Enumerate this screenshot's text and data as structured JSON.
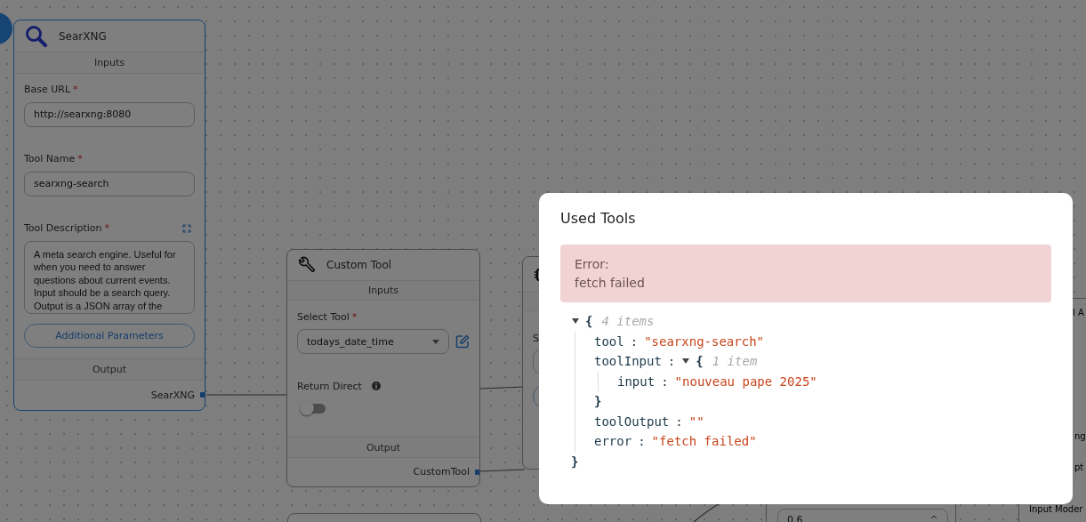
{
  "canvas": {
    "nodes": [
      {
        "kind": "tool",
        "title": "SearXNG",
        "selected": true,
        "inputs_heading": "Inputs",
        "fields": [
          {
            "kind": "text",
            "label": "Base URL",
            "required_mark": "*",
            "value": "http://searxng:8080"
          },
          {
            "kind": "text",
            "label": "Tool Name",
            "required_mark": "*",
            "value": "searxng-search"
          },
          {
            "kind": "textarea",
            "label": "Tool Description",
            "required_mark": "*",
            "expandable": true,
            "value": "A meta search engine. Useful for when you need to answer questions about current events. Input should be a search query. Output is a JSON array of the"
          }
        ],
        "button": "Additional Parameters",
        "output_heading": "Output",
        "output": "SearXNG"
      },
      {
        "kind": "tool",
        "title": "Custom Tool",
        "selected": false,
        "inputs_heading": "Inputs",
        "fields": [
          {
            "kind": "select",
            "label": "Select Tool",
            "required_mark": "*",
            "value": "todays_date_time",
            "editable": true
          },
          {
            "kind": "toggle",
            "label": "Return Direct",
            "info": true,
            "on": false
          }
        ],
        "output_heading": "Output",
        "output": "CustomTool"
      },
      {
        "kind": "partial",
        "selected": false,
        "label": "S"
      },
      {
        "kind": "empty",
        "selected": false
      },
      {
        "kind": "number",
        "selected": false,
        "value": "0.6"
      },
      {
        "kind": "clipped",
        "selected": false,
        "texts": [
          "l A",
          "ng",
          "pt",
          "Input Moder"
        ]
      }
    ]
  },
  "dialog": {
    "title": "Used Tools",
    "error": {
      "heading": "Error:",
      "message": "fetch failed"
    },
    "result": {
      "kind": "object",
      "expanded": true,
      "open": "{",
      "count": "4 items",
      "close": "}",
      "entries": [
        {
          "kind": "string",
          "key": "tool",
          "sep": ":",
          "value": "\"searxng-search\""
        },
        {
          "kind": "object",
          "key": "toolInput",
          "sep": ":",
          "expanded": true,
          "open": "{",
          "count": "1 item",
          "close": "}",
          "entries": [
            {
              "kind": "string",
              "key": "input",
              "sep": ":",
              "value": "\"nouveau pape 2025\""
            }
          ]
        },
        {
          "kind": "string",
          "key": "toolOutput",
          "sep": ":",
          "value": "\"\""
        },
        {
          "kind": "string",
          "key": "error",
          "sep": ":",
          "value": "\"fetch failed\""
        }
      ]
    }
  }
}
